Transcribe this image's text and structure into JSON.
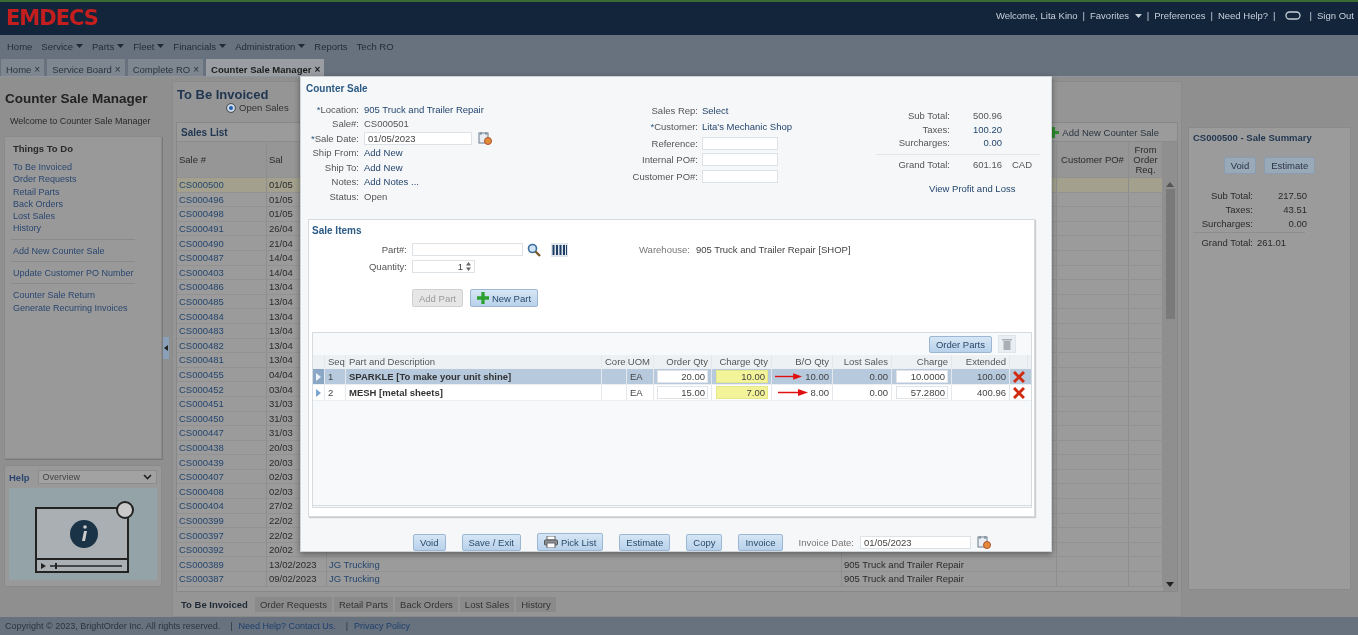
{
  "app": {
    "logo": "EMDECS"
  },
  "user_bar": {
    "separator": "|",
    "items": [
      {
        "kind": "text",
        "label": "Welcome, Lita Kino"
      },
      {
        "kind": "menu",
        "label": "Favorites"
      },
      {
        "kind": "link",
        "label": "Preferences"
      },
      {
        "kind": "link",
        "label": "Need Help?"
      },
      {
        "kind": "chat"
      },
      {
        "kind": "link",
        "label": "Sign Out"
      }
    ]
  },
  "menu": [
    {
      "label": "Home",
      "has_menu": false
    },
    {
      "label": "Service",
      "has_menu": true
    },
    {
      "label": "Parts",
      "has_menu": true
    },
    {
      "label": "Fleet",
      "has_menu": true
    },
    {
      "label": "Financials",
      "has_menu": true
    },
    {
      "label": "Administration",
      "has_menu": true
    },
    {
      "label": "Reports",
      "has_menu": false
    },
    {
      "label": "Tech RO",
      "has_menu": false
    }
  ],
  "tabs": [
    {
      "label": "Home",
      "close": "×",
      "selected": false
    },
    {
      "label": "Service Board",
      "close": "×",
      "selected": false
    },
    {
      "label": "Complete RO",
      "close": "×",
      "selected": false
    },
    {
      "label": "Counter Sale Manager",
      "close": "×",
      "selected": true
    }
  ],
  "sidebar": {
    "title": "Counter Sale Manager",
    "welcome": "Welcome to Counter Sale Manager",
    "todo_title": "Things To Do",
    "groups": [
      {
        "items": [
          "To Be Invoiced",
          "Order Requests",
          "Retail Parts",
          "Back Orders",
          "Lost Sales",
          "History"
        ]
      },
      {
        "items": [
          "Add New Counter Sale"
        ]
      },
      {
        "items": [
          "Update Customer PO Number"
        ]
      },
      {
        "items": [
          "Counter Sale Return",
          "Generate Recurring Invoices"
        ]
      }
    ]
  },
  "help": {
    "label": "Help",
    "topic": "Overview"
  },
  "main": {
    "title": "To Be Invoiced",
    "filter": {
      "label": "Open Sales",
      "selected": true
    },
    "sales_list": {
      "title": "Sales List",
      "add_button": "Add New Counter Sale",
      "columns": {
        "sale": "Sale #",
        "date": "Sal",
        "customer_po": "Customer PO#",
        "from_order_req": "From Order Req."
      },
      "rows": [
        {
          "sale": "CS000500",
          "date": "01/05",
          "selected": true
        },
        {
          "sale": "CS000496",
          "date": "01/05",
          "selected": false
        },
        {
          "sale": "CS000498",
          "date": "01/05",
          "selected": false
        },
        {
          "sale": "CS000491",
          "date": "26/04",
          "selected": false
        },
        {
          "sale": "CS000490",
          "date": "21/04",
          "selected": false
        },
        {
          "sale": "CS000487",
          "date": "14/04",
          "selected": false
        },
        {
          "sale": "CS000403",
          "date": "14/04",
          "selected": false
        },
        {
          "sale": "CS000486",
          "date": "13/04",
          "selected": false
        },
        {
          "sale": "CS000485",
          "date": "13/04",
          "selected": false
        },
        {
          "sale": "CS000484",
          "date": "13/04",
          "selected": false
        },
        {
          "sale": "CS000483",
          "date": "13/04",
          "selected": false
        },
        {
          "sale": "CS000482",
          "date": "13/04",
          "selected": false
        },
        {
          "sale": "CS000481",
          "date": "13/04",
          "selected": false
        },
        {
          "sale": "CS000455",
          "date": "04/04",
          "selected": false
        },
        {
          "sale": "CS000452",
          "date": "03/04",
          "selected": false
        },
        {
          "sale": "CS000451",
          "date": "31/03",
          "selected": false
        },
        {
          "sale": "CS000450",
          "date": "31/03",
          "selected": false
        },
        {
          "sale": "CS000447",
          "date": "31/03",
          "selected": false
        },
        {
          "sale": "CS000438",
          "date": "20/03",
          "selected": false
        },
        {
          "sale": "CS000439",
          "date": "20/03",
          "selected": false
        },
        {
          "sale": "CS000407",
          "date": "02/03",
          "selected": false
        },
        {
          "sale": "CS000408",
          "date": "02/03",
          "selected": false
        },
        {
          "sale": "CS000404",
          "date": "27/02",
          "selected": false
        },
        {
          "sale": "CS000399",
          "date": "22/02",
          "selected": false
        },
        {
          "sale": "CS000397",
          "date": "22/02",
          "selected": false
        },
        {
          "sale": "CS000392",
          "date": "20/02",
          "selected": false
        },
        {
          "sale": "CS000389",
          "date": "13/02/2023",
          "customer": "JG Trucking",
          "location": "905 Truck and Trailer Repair",
          "selected": false
        },
        {
          "sale": "CS000387",
          "date": "09/02/2023",
          "customer": "JG Trucking",
          "location": "905 Truck and Trailer Repair",
          "selected": false
        }
      ]
    },
    "bottom_tabs": [
      {
        "label": "To Be Invoiced",
        "selected": true
      },
      {
        "label": "Order Requests",
        "selected": false
      },
      {
        "label": "Retail Parts",
        "selected": false
      },
      {
        "label": "Back Orders",
        "selected": false
      },
      {
        "label": "Lost Sales",
        "selected": false
      },
      {
        "label": "History",
        "selected": false
      }
    ]
  },
  "summary": {
    "title": "CS000500 - Sale Summary",
    "buttons": [
      "Void",
      "Estimate"
    ],
    "totals": [
      {
        "label": "Sub Total:",
        "value": "217.50",
        "kind": "text"
      },
      {
        "label": "Taxes:",
        "value": "43.51",
        "kind": "text"
      },
      {
        "label": "Surcharges:",
        "value": "0.00",
        "kind": "text"
      },
      {
        "label": "Grand Total:",
        "value": "261.01",
        "kind": "grand"
      }
    ]
  },
  "footer": {
    "separator": "|",
    "copyright": "Copyright © 2023, BrightOrder Inc. All rights reserved.",
    "links": [
      "Need Help? Contact Us.",
      "Privacy Policy"
    ]
  },
  "dialog": {
    "title": "Counter Sale",
    "required_mark": "*",
    "left_fields": [
      {
        "label": "Location:",
        "required": true,
        "kind": "link",
        "value": "905 Truck and Trailer Repair"
      },
      {
        "label": "Sale#:",
        "required": false,
        "kind": "text",
        "value": "CS000501"
      },
      {
        "label": "Sale Date:",
        "required": true,
        "kind": "date",
        "value": "01/05/2023"
      },
      {
        "label": "Ship From:",
        "required": false,
        "kind": "link",
        "value": "Add New"
      },
      {
        "label": "Ship To:",
        "required": false,
        "kind": "link",
        "value": "Add New"
      },
      {
        "label": "Notes:",
        "required": false,
        "kind": "link",
        "value": "Add Notes ..."
      },
      {
        "label": "Status:",
        "required": false,
        "kind": "text",
        "value": "Open"
      }
    ],
    "middle_fields": [
      {
        "label": "Sales Rep:",
        "required": false,
        "kind": "link",
        "value": "Select"
      },
      {
        "label": "Customer:",
        "required": true,
        "kind": "link",
        "value": "Lita's Mechanic Shop"
      },
      {
        "label": "Reference:",
        "required": false,
        "kind": "input"
      },
      {
        "label": "Internal PO#:",
        "required": false,
        "kind": "input"
      },
      {
        "label": "Customer PO#:",
        "required": false,
        "kind": "input"
      }
    ],
    "totals": [
      {
        "label": "Sub Total:",
        "value": "500.96",
        "kind": "text"
      },
      {
        "label": "Taxes:",
        "value": "100.20",
        "kind": "link"
      },
      {
        "label": "Surcharges:",
        "value": "0.00",
        "kind": "link"
      },
      {
        "label": "Grand Total:",
        "value": "601.16",
        "currency": "CAD",
        "kind": "grand"
      }
    ],
    "profit_link": "View Profit and Loss",
    "items": {
      "title": "Sale Items",
      "part_label": "Part#:",
      "quantity_label": "Quantity:",
      "quantity": "1",
      "warehouse_label": "Warehouse:",
      "warehouse": "905 Truck and Trailer Repair [SHOP]",
      "add_part": {
        "label": "Add Part",
        "disabled": true
      },
      "new_part": {
        "label": "New Part",
        "disabled": false
      },
      "order_parts": "Order Parts",
      "delete_all": {
        "disabled": true
      },
      "columns": [
        "Seq",
        "Part and Description",
        "Core",
        "UOM",
        "Order Qty",
        "Charge Qty",
        "B/O Qty",
        "Lost Sales",
        "Charge",
        "Extended"
      ],
      "rows": [
        {
          "seq": "1",
          "part": "SPARKLE [To make your unit shine]",
          "uom": "EA",
          "order_qty": "20.00",
          "charge_qty": "10.00",
          "bo_qty": "10.00",
          "lost_sales": "0.00",
          "charge": "10.0000",
          "extended": "100.00",
          "selected": true,
          "arrow": true
        },
        {
          "seq": "2",
          "part": "MESH [metal sheets]",
          "uom": "EA",
          "order_qty": "15.00",
          "charge_qty": "7.00",
          "bo_qty": "8.00",
          "lost_sales": "0.00",
          "charge": "57.2800",
          "extended": "400.96",
          "selected": false,
          "arrow": true
        }
      ]
    },
    "actions": [
      {
        "label": "Void",
        "kind": "button"
      },
      {
        "label": "Save / Exit",
        "kind": "button"
      },
      {
        "label": "Pick List",
        "kind": "print"
      },
      {
        "label": "Estimate",
        "kind": "button"
      },
      {
        "label": "Copy",
        "kind": "button"
      },
      {
        "label": "Invoice",
        "kind": "button"
      }
    ],
    "invoice_date": {
      "label": "Invoice Date:",
      "value": "01/05/2023"
    }
  }
}
